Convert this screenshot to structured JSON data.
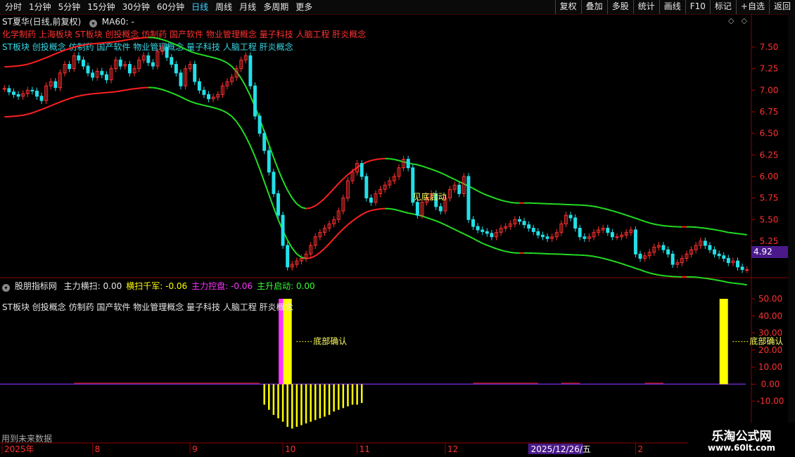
{
  "toolbar": {
    "tabs": [
      "分时",
      "1分钟",
      "5分钟",
      "15分钟",
      "30分钟",
      "60分钟",
      "日线",
      "周线",
      "月线",
      "多周期",
      "更多"
    ],
    "active_tab": "日线",
    "right_buttons": [
      "复权",
      "叠加",
      "多股",
      "统计",
      "画线",
      "F10",
      "标记",
      "+自选",
      "返回"
    ]
  },
  "header": {
    "title": "ST夏华(日线,前复权)",
    "ma_label": "MA60: -"
  },
  "concepts": {
    "line1": "化学制药 上海板块 ST板块 创投概念 仿制药 国产软件 物业管理概念 量子科技 人脑工程 肝炎概念",
    "line2": "ST板块 创投概念 仿制药 国产软件 物业管理概念 量子科技 人脑工程 肝炎概念",
    "line3": "ST板块 创投概念 仿制药 国产软件 物业管理概念 量子科技 人脑工程 肝炎概念"
  },
  "indicator": {
    "name": "股朋指标网",
    "items": [
      {
        "label": "主力横扫: 0.00",
        "color": "#e6e6e6"
      },
      {
        "label": "横扫千军: -0.06",
        "color": "#ffff00"
      },
      {
        "label": "主力控盘: -0.06",
        "color": "#ff33ff"
      },
      {
        "label": "主升启动: 0.00",
        "color": "#33ff33"
      }
    ]
  },
  "current_price": "4.92",
  "future_note": "用到未来数据",
  "watermark": {
    "line1": "乐淘公式网",
    "line2": "www.60lt.com"
  },
  "chart_data": [
    {
      "type": "candlestick",
      "title": "",
      "y_ticks": [
        5.25,
        5.5,
        5.75,
        6.0,
        6.25,
        6.5,
        6.75,
        7.0,
        7.25,
        7.5
      ],
      "ylim": [
        4.85,
        7.72
      ],
      "x_labels": [
        {
          "label": "2025年",
          "i": 0
        },
        {
          "label": "8",
          "i": 19
        },
        {
          "label": "9",
          "i": 40
        },
        {
          "label": "10",
          "i": 60
        },
        {
          "label": "11",
          "i": 76
        },
        {
          "label": "12",
          "i": 95
        },
        {
          "label": "2025/12/26/五",
          "i": 113
        },
        {
          "label": "2",
          "i": 136
        }
      ],
      "annotations": [
        {
          "text": "见底启动",
          "i": 88,
          "y": 5.73
        }
      ],
      "n": 161,
      "closes": [
        7.02,
        6.98,
        6.95,
        6.93,
        6.96,
        7.0,
        6.99,
        6.93,
        6.88,
        7.05,
        7.1,
        7.03,
        7.2,
        7.3,
        7.25,
        7.4,
        7.35,
        7.28,
        7.2,
        7.15,
        7.22,
        7.18,
        7.12,
        7.25,
        7.35,
        7.28,
        7.3,
        7.2,
        7.25,
        7.35,
        7.4,
        7.32,
        7.28,
        7.45,
        7.5,
        7.38,
        7.3,
        7.2,
        7.05,
        7.25,
        7.3,
        7.1,
        7.0,
        6.95,
        6.9,
        6.92,
        6.95,
        7.05,
        7.1,
        7.15,
        7.25,
        7.35,
        7.4,
        7.05,
        6.7,
        6.5,
        6.3,
        6.05,
        5.8,
        5.55,
        5.2,
        4.95,
        4.98,
        5.02,
        5.05,
        5.1,
        5.2,
        5.3,
        5.35,
        5.4,
        5.45,
        5.5,
        5.6,
        5.75,
        5.95,
        6.05,
        6.15,
        6.0,
        5.75,
        5.7,
        5.8,
        5.85,
        5.9,
        5.95,
        6.0,
        6.1,
        6.2,
        6.1,
        5.7,
        5.55,
        5.7,
        5.75,
        5.8,
        5.65,
        5.6,
        5.75,
        5.85,
        5.9,
        5.8,
        6.0,
        5.5,
        5.42,
        5.38,
        5.36,
        5.34,
        5.3,
        5.35,
        5.4,
        5.42,
        5.45,
        5.5,
        5.48,
        5.44,
        5.4,
        5.36,
        5.32,
        5.3,
        5.28,
        5.3,
        5.35,
        5.45,
        5.55,
        5.52,
        5.4,
        5.3,
        5.28,
        5.3,
        5.35,
        5.38,
        5.4,
        5.35,
        5.3,
        5.3,
        5.32,
        5.35,
        5.38,
        5.1,
        5.05,
        5.08,
        5.12,
        5.18,
        5.2,
        5.15,
        5.1,
        4.98,
        5.0,
        5.05,
        5.1,
        5.15,
        5.2,
        5.25,
        5.2,
        5.15,
        5.1,
        5.08,
        5.05,
        5.0,
        5.02,
        4.95,
        4.92,
        4.92
      ]
    },
    {
      "type": "bar",
      "title": "",
      "y_ticks": [
        -10,
        0,
        10,
        20,
        30,
        40,
        50
      ],
      "ylim": [
        -27,
        57
      ],
      "bars": [
        {
          "name": "主力控盘",
          "color": "#ff33ff",
          "i": 60,
          "value": 50
        },
        {
          "name": "横扫千军",
          "color": "#ffff00",
          "i": 61,
          "value": 50
        },
        {
          "name": "横扫千军",
          "color": "#ffff00",
          "i": 155,
          "value": 50
        }
      ],
      "negative_bars": {
        "color": "#ffff00",
        "start": 56,
        "values": [
          -12,
          -15,
          -18,
          -20,
          -22,
          -25,
          -26,
          -25,
          -24,
          -23,
          -22,
          -21,
          -20,
          -19,
          -18,
          -16,
          -15,
          -14,
          -13,
          -12,
          -12,
          -11
        ]
      },
      "annotations": [
        {
          "text": "底部确认",
          "i": 62,
          "y": 25
        },
        {
          "text": "底部确认",
          "i": 156,
          "y": 25
        }
      ]
    }
  ]
}
